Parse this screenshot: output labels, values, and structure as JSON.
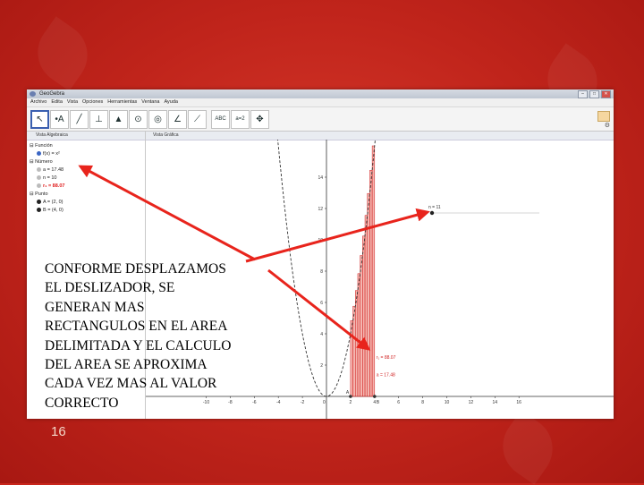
{
  "window": {
    "title": "GeoGebra",
    "menu": [
      "Archivo",
      "Edita",
      "Vista",
      "Opciones",
      "Herramientas",
      "Ventana",
      "Ayuda"
    ],
    "tools": [
      {
        "icon": "move-arrow-icon",
        "glyph": "↖"
      },
      {
        "icon": "point-icon",
        "glyph": "•A"
      },
      {
        "icon": "line-icon",
        "glyph": "╱"
      },
      {
        "icon": "perpendicular-icon",
        "glyph": "⊥"
      },
      {
        "icon": "polygon-icon",
        "glyph": "▲"
      },
      {
        "icon": "circle-icon",
        "glyph": "⊙"
      },
      {
        "icon": "ellipse-icon",
        "glyph": "◎"
      },
      {
        "icon": "angle-icon",
        "glyph": "∠"
      },
      {
        "icon": "reflect-icon",
        "glyph": "⟋"
      },
      {
        "icon": "text-abc-icon",
        "glyph": "ABC"
      },
      {
        "icon": "slider-icon",
        "glyph": "a=2"
      },
      {
        "icon": "move-view-icon",
        "glyph": "✥"
      }
    ]
  },
  "algebra_view": {
    "title": "Vista Algebraica",
    "groups": [
      {
        "label": "Función",
        "items": [
          "f(x) = x²"
        ]
      },
      {
        "label": "Número",
        "items": [
          "a = 17.48",
          "n = 10",
          "r₁ = 88.07"
        ]
      },
      {
        "label": "Punto",
        "items": [
          "A = (2, 0)",
          "B = (4, 0)"
        ]
      }
    ]
  },
  "graphics_view": {
    "title": "Vista Gráfica",
    "slider_label": "n = 11",
    "label_r": "r₁ = 88.07",
    "label_a": "a = 17.48",
    "point_A": "A",
    "point_B": "B"
  },
  "chart_data": {
    "type": "line",
    "function": "f(x) = x^2",
    "xlim": [
      -10,
      16
    ],
    "ylim": [
      0,
      16
    ],
    "x_ticks": [
      -10,
      -8,
      -6,
      -4,
      -2,
      0,
      2,
      4,
      6,
      8,
      10,
      12,
      14,
      16
    ],
    "y_ticks": [
      2,
      4,
      6,
      8,
      10,
      12,
      14
    ],
    "interval": [
      2,
      4
    ],
    "rectangles": 10,
    "grid": false
  },
  "overlay": {
    "lines": [
      "CONFORME DESPLAZAMOS",
      "EL DESLIZADOR, SE",
      "GENERAN MAS",
      "RECTANGULOS EN EL AREA",
      "DELIMITADA Y EL CALCULO",
      "DEL AREA SE APROXIMA",
      "CADA VEZ MAS AL VALOR",
      "CORRECTO"
    ],
    "arrow_color": "#e8241c"
  },
  "slide_number": "16"
}
